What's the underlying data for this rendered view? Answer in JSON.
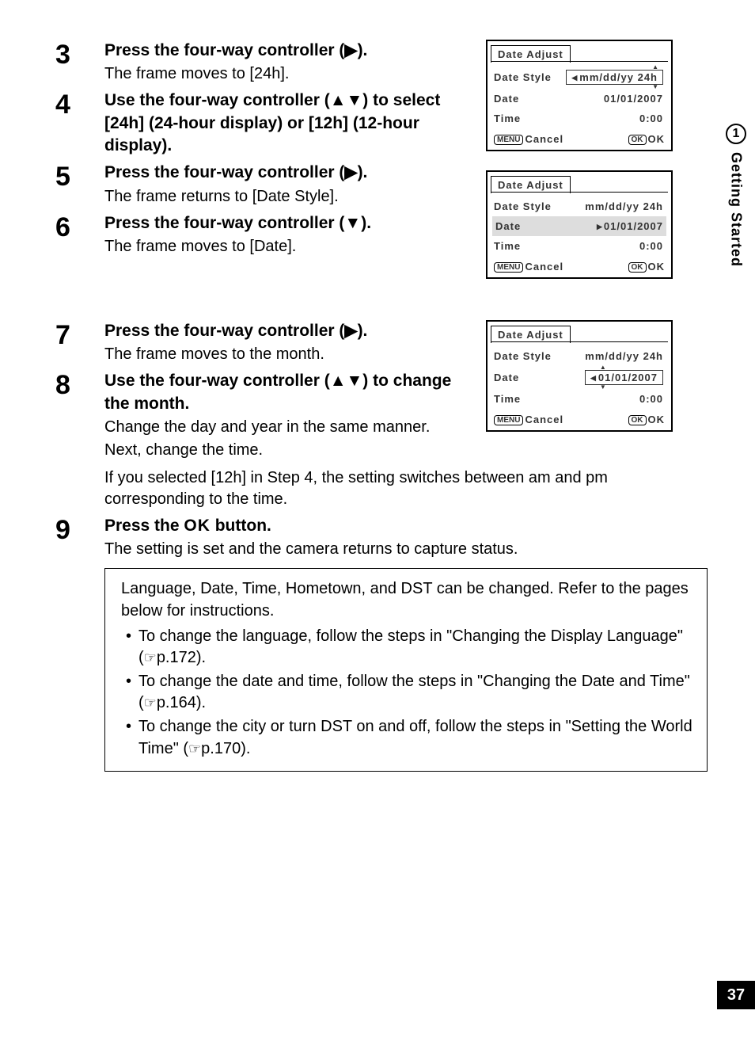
{
  "sidebar": {
    "chapter_num": "1",
    "chapter_title": "Getting Started"
  },
  "page_number": "37",
  "steps": {
    "s3": {
      "num": "3",
      "title_a": "Press the four-way controller (",
      "title_b": ").",
      "arrow": "▶",
      "desc": "The frame moves to [24h]."
    },
    "s4": {
      "num": "4",
      "title_a": "Use the four-way controller (",
      "title_b": ") to select [24h] (24-hour display) or [12h] (12-hour display).",
      "arrows": "▲▼"
    },
    "s5": {
      "num": "5",
      "title_a": "Press the four-way controller (",
      "title_b": ").",
      "arrow": "▶",
      "desc": "The frame returns to [Date Style]."
    },
    "s6": {
      "num": "6",
      "title_a": "Press the four-way controller (",
      "title_b": ").",
      "arrow": "▼",
      "desc": "The frame moves to [Date]."
    },
    "s7": {
      "num": "7",
      "title_a": "Press the four-way controller (",
      "title_b": ").",
      "arrow": "▶",
      "desc": "The frame moves to the month."
    },
    "s8": {
      "num": "8",
      "title_a": "Use the four-way controller (",
      "title_b": ") to change the month.",
      "arrows": "▲▼",
      "desc1": "Change the day and year in the same manner.",
      "desc2": "Next, change the time.",
      "desc3": "If you selected [12h] in Step 4, the setting switches between am and pm corresponding to the time."
    },
    "s9": {
      "num": "9",
      "title_a": "Press the ",
      "title_ok": "OK",
      "title_b": " button.",
      "desc": "The setting is set and the camera returns to capture status."
    }
  },
  "lcd": {
    "title": "Date Adjust",
    "rows": {
      "date_style": "Date Style",
      "date": "Date",
      "time": "Time"
    },
    "values": {
      "style": "mm/dd/yy",
      "fmt": "24h",
      "date": "01/01/2007",
      "time": "0:00"
    },
    "bottom": {
      "menu": "MENU",
      "cancel": "Cancel",
      "ok_btn": "OK",
      "ok_lbl": "OK"
    }
  },
  "note": {
    "intro": "Language, Date, Time, Hometown, and DST can be changed. Refer to the pages below for instructions.",
    "b1a": "To change the language, follow the steps in \"Changing the Display Language\" (",
    "b1b": "p.172).",
    "b2a": "To change the date and time, follow the steps in \"Changing the Date and Time\" (",
    "b2b": "p.164).",
    "b3a": "To change the city or turn DST on and off, follow the steps in \"Setting the World Time\" (",
    "b3b": "p.170)."
  }
}
